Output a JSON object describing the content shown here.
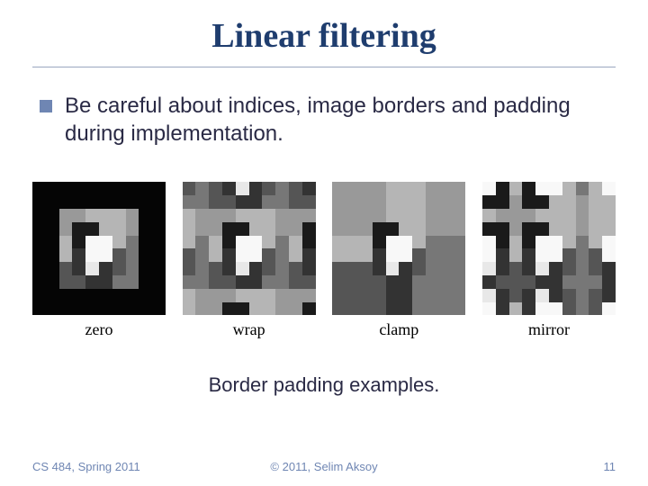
{
  "title": "Linear filtering",
  "bullet": "Be careful about indices, image borders and padding during implementation.",
  "figures": [
    {
      "label": "zero"
    },
    {
      "label": "wrap"
    },
    {
      "label": "clamp"
    },
    {
      "label": "mirror"
    }
  ],
  "caption": "Border padding examples.",
  "footer": {
    "left": "CS 484, Spring 2011",
    "center": "© 2011, Selim Aksoy",
    "right": "11"
  }
}
